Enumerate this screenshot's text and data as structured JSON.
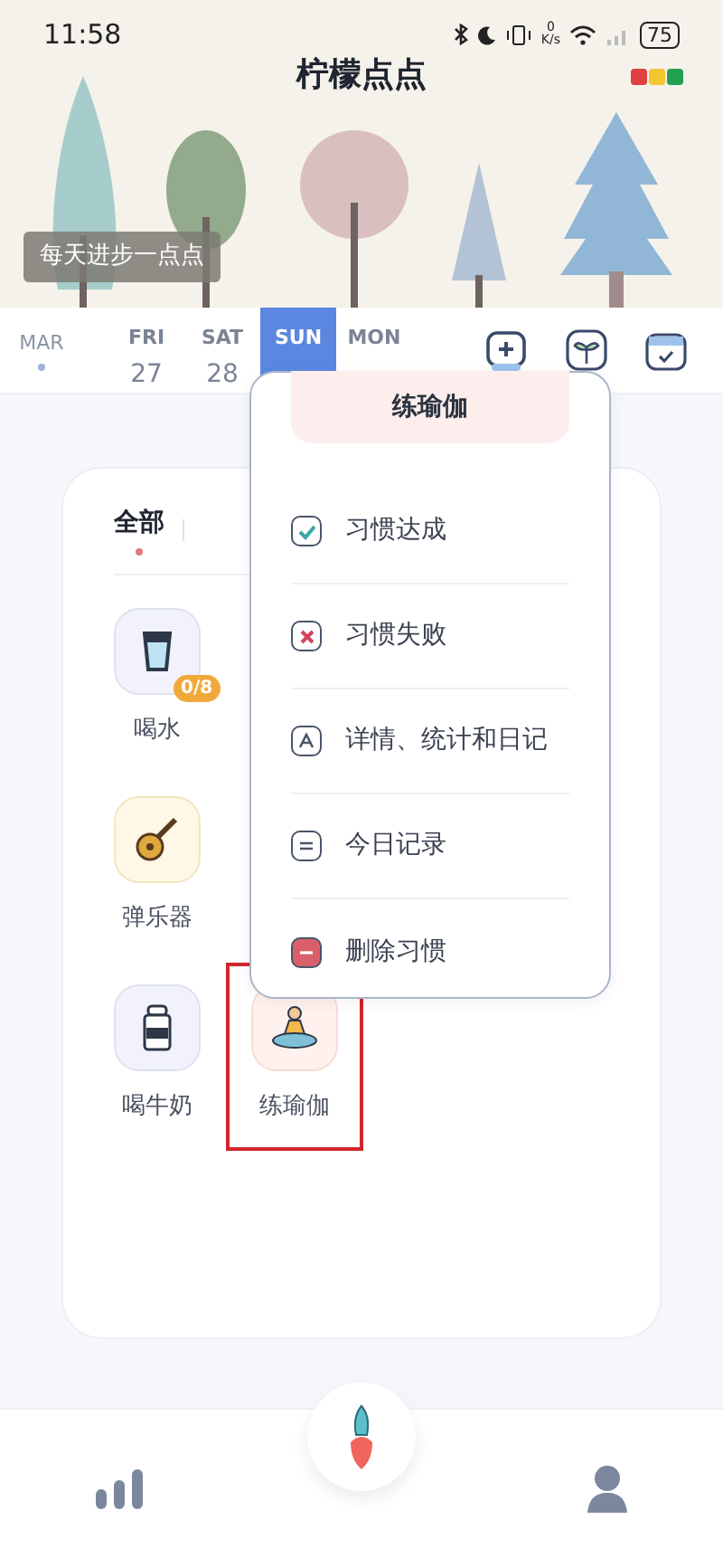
{
  "status_bar": {
    "time": "11:58",
    "net_speed_value": "0",
    "net_speed_unit": "K/s",
    "battery": "75"
  },
  "header": {
    "title": "柠檬点点",
    "slogan": "每天进步一点点"
  },
  "date_strip": {
    "month": "MAR",
    "days": [
      {
        "weekday": "FRI",
        "day": "27",
        "selected": false
      },
      {
        "weekday": "SAT",
        "day": "28",
        "selected": false
      },
      {
        "weekday": "SUN",
        "selected": true
      },
      {
        "weekday": "MON",
        "selected": false
      }
    ]
  },
  "tabs": [
    {
      "label": "全部",
      "selected": true
    }
  ],
  "habit_rows": [
    [
      {
        "name": "喝水",
        "kind": "water",
        "badge": "0/8",
        "highlighted": false
      }
    ],
    [
      {
        "name": "弹乐器",
        "kind": "guitar",
        "highlighted": false
      }
    ],
    [
      {
        "name": "喝牛奶",
        "kind": "milk",
        "highlighted": false
      },
      {
        "name": "练瑜伽",
        "kind": "yoga",
        "highlighted": true
      }
    ]
  ],
  "menu": {
    "title": "练瑜伽",
    "items": [
      {
        "kind": "done",
        "label": "习惯达成"
      },
      {
        "kind": "fail",
        "label": "习惯失败"
      },
      {
        "kind": "details",
        "label": "详情、统计和日记"
      },
      {
        "kind": "record",
        "label": "今日记录"
      },
      {
        "kind": "delete",
        "label": "删除习惯"
      }
    ]
  }
}
